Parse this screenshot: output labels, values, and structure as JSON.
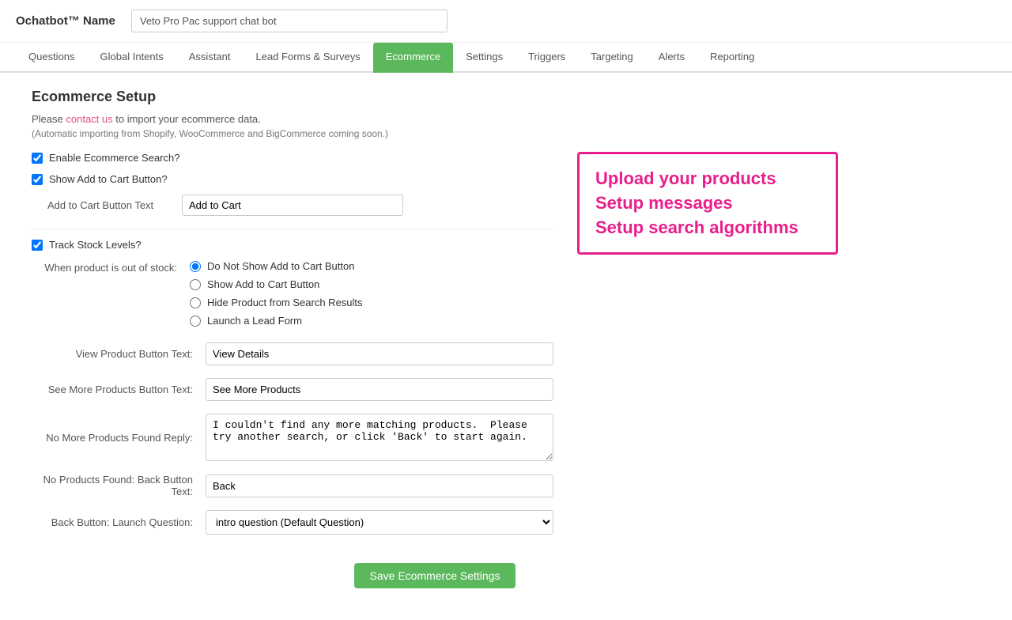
{
  "header": {
    "title": "Ochatbot™ Name",
    "bot_name_placeholder": "Veto Pro Pac support chat bot",
    "bot_name_value": "Veto Pro Pac support chat bot"
  },
  "nav": {
    "items": [
      {
        "label": "Questions",
        "active": false
      },
      {
        "label": "Global Intents",
        "active": false
      },
      {
        "label": "Assistant",
        "active": false
      },
      {
        "label": "Lead Forms & Surveys",
        "active": false
      },
      {
        "label": "Ecommerce",
        "active": true
      },
      {
        "label": "Settings",
        "active": false
      },
      {
        "label": "Triggers",
        "active": false
      },
      {
        "label": "Targeting",
        "active": false
      },
      {
        "label": "Alerts",
        "active": false
      },
      {
        "label": "Reporting",
        "active": false
      }
    ]
  },
  "main": {
    "section_title": "Ecommerce Setup",
    "desc_prefix": "Please ",
    "desc_link": "contact us",
    "desc_suffix": " to import your ecommerce data.",
    "desc_sub": "(Automatic importing from Shopify, WooCommerce and BigCommerce coming soon.)",
    "enable_ecommerce_label": "Enable Ecommerce Search?",
    "show_add_to_cart_label": "Show Add to Cart Button?",
    "add_to_cart_button_text_label": "Add to Cart Button Text",
    "add_to_cart_button_text_value": "Add to Cart",
    "track_stock_label": "Track Stock Levels?",
    "out_of_stock_label": "When product is out of stock:",
    "out_of_stock_options": [
      {
        "label": "Do Not Show Add to Cart Button",
        "selected": true
      },
      {
        "label": "Show Add to Cart Button",
        "selected": false
      },
      {
        "label": "Hide Product from Search Results",
        "selected": false
      },
      {
        "label": "Launch a Lead Form",
        "selected": false
      }
    ],
    "view_product_label": "View Product Button Text:",
    "view_product_value": "View Details",
    "see_more_label": "See More Products Button Text:",
    "see_more_value": "See More Products",
    "no_more_products_label": "No More Products Found Reply:",
    "no_more_products_value": "I couldn't find any more matching products.  Please try another search, or click 'Back' to start again.",
    "no_products_back_label": "No Products Found: Back Button Text:",
    "no_products_back_value": "Back",
    "back_button_launch_label": "Back Button: Launch Question:",
    "back_button_launch_value": "intro question (Default Question)",
    "back_button_options": [
      {
        "label": "intro question (Default Question)",
        "value": "intro"
      }
    ],
    "save_button_label": "Save Ecommerce Settings"
  },
  "callout": {
    "line1": "Upload your products",
    "line2": "Setup messages",
    "line3": "Setup search algorithms"
  }
}
